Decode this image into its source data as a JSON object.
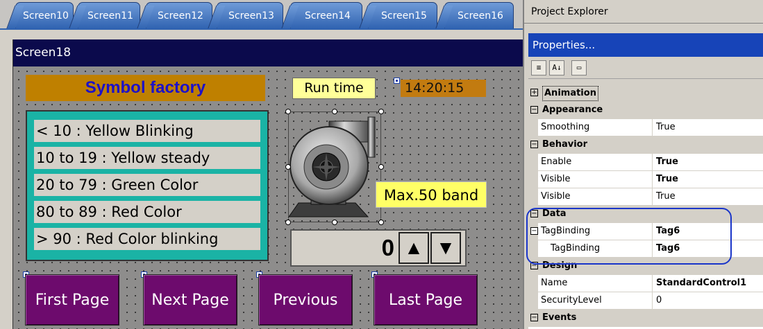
{
  "tabs": [
    "Screen10",
    "Screen11",
    "Screen12",
    "Screen13",
    "Screen14",
    "Screen15",
    "Screen16"
  ],
  "screen": {
    "title": "Screen18",
    "symbol_title": "Symbol factory",
    "runtime_label": "Run time",
    "clock": "14:20:15",
    "legend": [
      "< 10 : Yellow Blinking",
      "10 to 19 : Yellow steady",
      "20 to 79 : Green Color",
      "80 to 89 : Red Color",
      "> 90 : Red Color blinking"
    ],
    "max_band": "Max.50 band",
    "spinner_value": "0",
    "spinner_up": "▲",
    "spinner_down": "▼",
    "nav_buttons": [
      "First Page",
      "Next Page",
      "Previous",
      "Last Page"
    ]
  },
  "panel": {
    "project_explorer": "Project Explorer",
    "properties_title": "Properties...",
    "toolbar": {
      "categorized": "≡",
      "alpha": "A↓",
      "pages": "▭"
    },
    "rows": [
      {
        "type": "cat",
        "expander": "+",
        "name": "Animation"
      },
      {
        "type": "cat",
        "expander": "−",
        "name": "Appearance"
      },
      {
        "type": "prop",
        "name": "Smoothing",
        "value": "True"
      },
      {
        "type": "cat",
        "expander": "−",
        "name": "Behavior"
      },
      {
        "type": "prop",
        "name": "Enable",
        "value": "True"
      },
      {
        "type": "prop",
        "name": "Visible",
        "value": "True"
      },
      {
        "type": "prop",
        "name": "Visible",
        "value": "True"
      },
      {
        "type": "cat",
        "expander": "−",
        "name": "Data"
      },
      {
        "type": "prop",
        "name": "TagBinding",
        "value": "Tag6"
      },
      {
        "type": "prop",
        "name": "TagBinding",
        "value": "Tag6"
      },
      {
        "type": "cat",
        "expander": "−",
        "name": "Design"
      },
      {
        "type": "prop",
        "name": "Name",
        "value": "StandardControl1"
      },
      {
        "type": "prop",
        "name": "SecurityLevel",
        "value": "0"
      },
      {
        "type": "cat",
        "expander": "−",
        "name": "Events"
      }
    ]
  },
  "colors": {
    "screen_title_bg": "#0b0a4c",
    "symbol_title_bg": "#bf8000",
    "symbol_title_fg": "#1d11c8",
    "legend_bg": "#1ab3a5",
    "nav_button_bg": "#6d0b6d",
    "properties_title_bg": "#1744b8",
    "highlight": "#1a35c9"
  },
  "icons": {
    "pump": "centrifugal-pump-icon",
    "tag_marker": "tag-marker-icon"
  }
}
